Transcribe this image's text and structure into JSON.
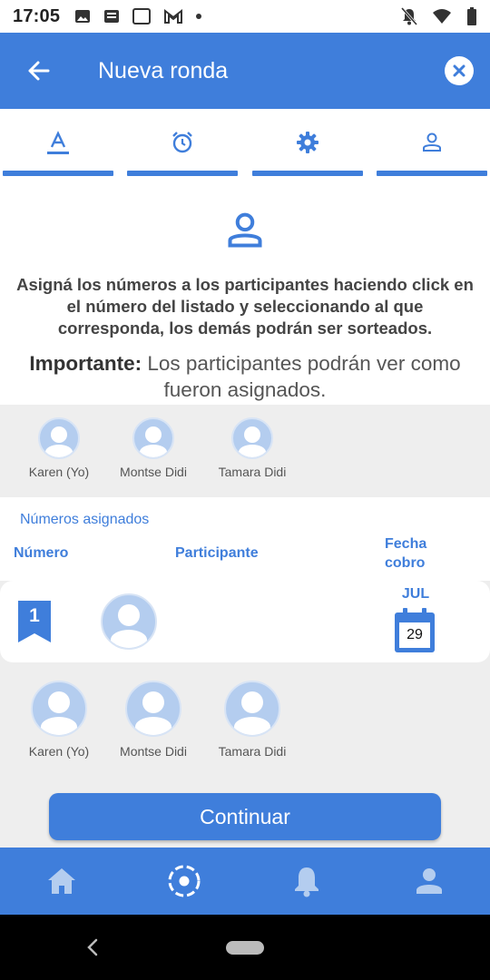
{
  "status_bar": {
    "time": "17:05"
  },
  "app_bar": {
    "title": "Nueva ronda"
  },
  "tabs": [
    {
      "icon": "text-format-icon",
      "active": true
    },
    {
      "icon": "alarm-icon"
    },
    {
      "icon": "gear-icon"
    },
    {
      "icon": "person-icon"
    }
  ],
  "intro": {
    "instructions": "Asigná los números a los participantes haciendo click en el número del listado y seleccionando al que corresponda, los demás podrán ser sorteados.",
    "note_bold": "Importante:",
    "note_text": " Los participantes podrán ver como fueron asignados."
  },
  "participants_top": [
    "Karen (Yo)",
    "Montse Didi",
    "Tamara Didi"
  ],
  "assigned": {
    "subtitle": "Números asignados",
    "col_number": "Número",
    "col_participant": "Participante",
    "col_date_line1": "Fecha",
    "col_date_line2": "cobro"
  },
  "rows": [
    {
      "number": "1",
      "month": "JUL",
      "day": "29"
    }
  ],
  "participants_bottom": [
    "Karen (Yo)",
    "Montse Didi",
    "Tamara Didi"
  ],
  "continue_label": "Continuar",
  "bottom_nav": [
    "home-icon",
    "round-icon",
    "bell-icon",
    "profile-icon"
  ],
  "colors": {
    "primary": "#3f7edb",
    "avatar_fill": "#b4cdef",
    "background": "#eeeeee"
  }
}
